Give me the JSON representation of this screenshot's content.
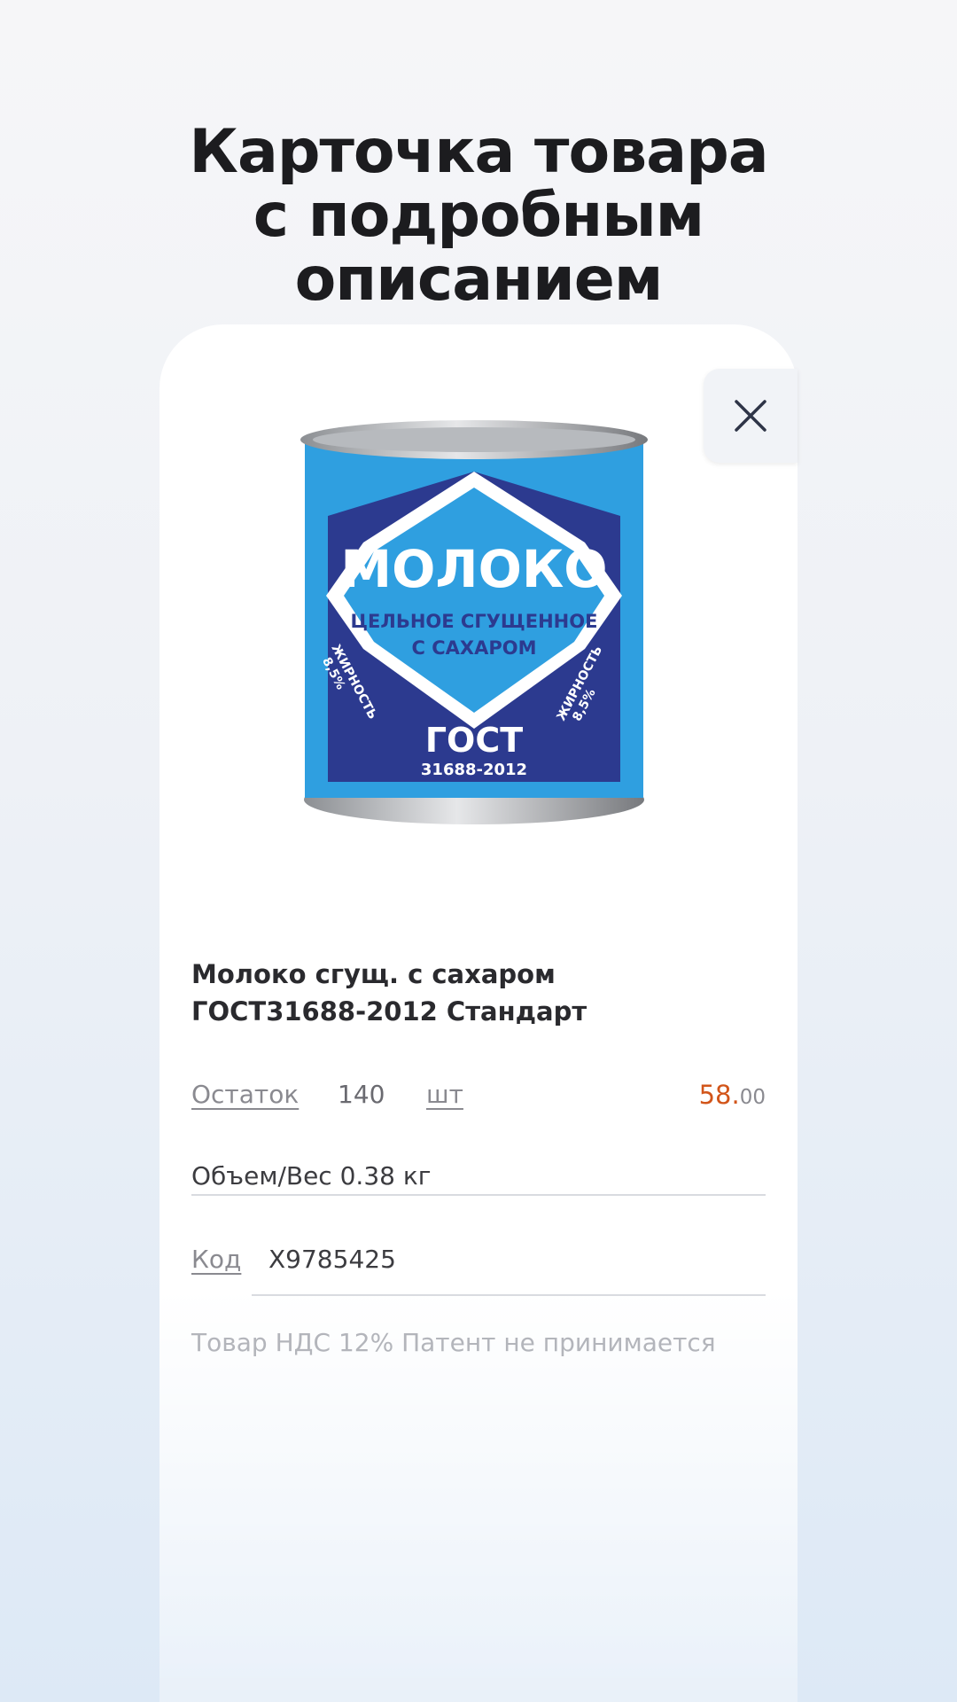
{
  "header": {
    "line1": "Карточка товара",
    "line2": "с подробным",
    "line3": "описанием"
  },
  "product": {
    "image": {
      "brand": "МОЛОКО",
      "line1": "ЦЕЛЬНОЕ СГУЩЕННОЕ",
      "line2": "С САХАРОМ",
      "side_label": "ЖИРНОСТЬ",
      "side_value": "8,5%",
      "standard": "ГОСТ",
      "standard_code": "31688-2012",
      "colors": {
        "light_blue": "#2f9fe0",
        "dark_blue": "#2c3a8f",
        "white": "#ffffff"
      }
    },
    "title_line1": "Молоко сгущ. с сахаром",
    "title_line2": "ГОСТ31688-2012  Стандарт",
    "stock": {
      "label": "Остаток",
      "value": "140",
      "unit": "шт"
    },
    "price": {
      "integer": "58.",
      "decimal": "00",
      "color": "#d2551a"
    },
    "weight": "Объем/Вес 0.38 кг",
    "code": {
      "label": "Код",
      "value": "X9785425"
    },
    "note": "Товар НДС 12% Патент не принимается"
  },
  "controls": {
    "close_icon": "close-icon"
  }
}
